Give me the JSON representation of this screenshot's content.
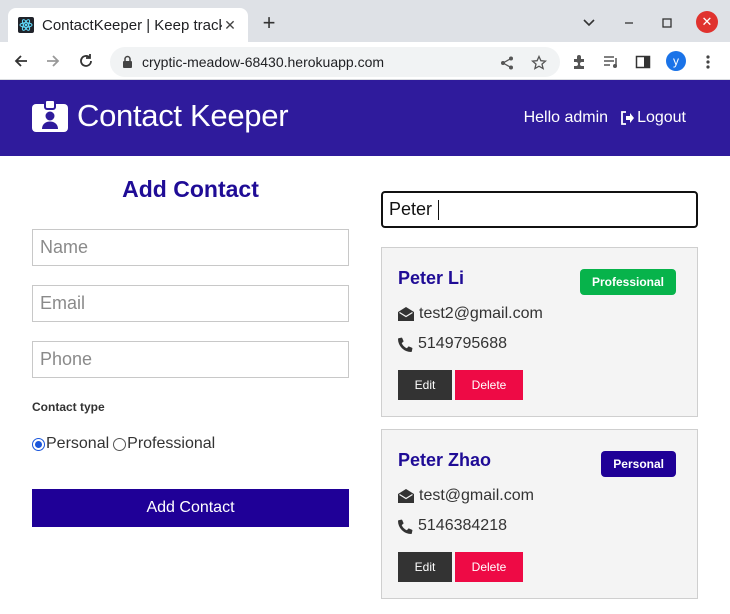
{
  "browser": {
    "tab_title": "ContactKeeper | Keep track",
    "url": "cryptic-meadow-68430.herokuapp.com",
    "profile_initial": "y"
  },
  "app": {
    "brand": "Contact Keeper",
    "greeting": "Hello admin",
    "logout": "Logout"
  },
  "form": {
    "title": "Add Contact",
    "name_placeholder": "Name",
    "email_placeholder": "Email",
    "phone_placeholder": "Phone",
    "type_label": "Contact type",
    "type_options": [
      {
        "label": "Personal",
        "selected": true
      },
      {
        "label": "Professional",
        "selected": false
      }
    ],
    "submit": "Add Contact"
  },
  "filter": {
    "value": "Peter"
  },
  "contacts": [
    {
      "name": "Peter Li",
      "type": "Professional",
      "badge_color": "#07b34b",
      "email": "test2@gmail.com",
      "phone": "5149795688",
      "edit": "Edit",
      "delete": "Delete"
    },
    {
      "name": "Peter Zhao",
      "type": "Personal",
      "badge_color": "#1f0097",
      "email": "test@gmail.com",
      "phone": "5146384218",
      "edit": "Edit",
      "delete": "Delete"
    }
  ],
  "colors": {
    "navbar": "#2f1b9c",
    "primary": "#1f0097",
    "danger": "#ee0a45"
  }
}
